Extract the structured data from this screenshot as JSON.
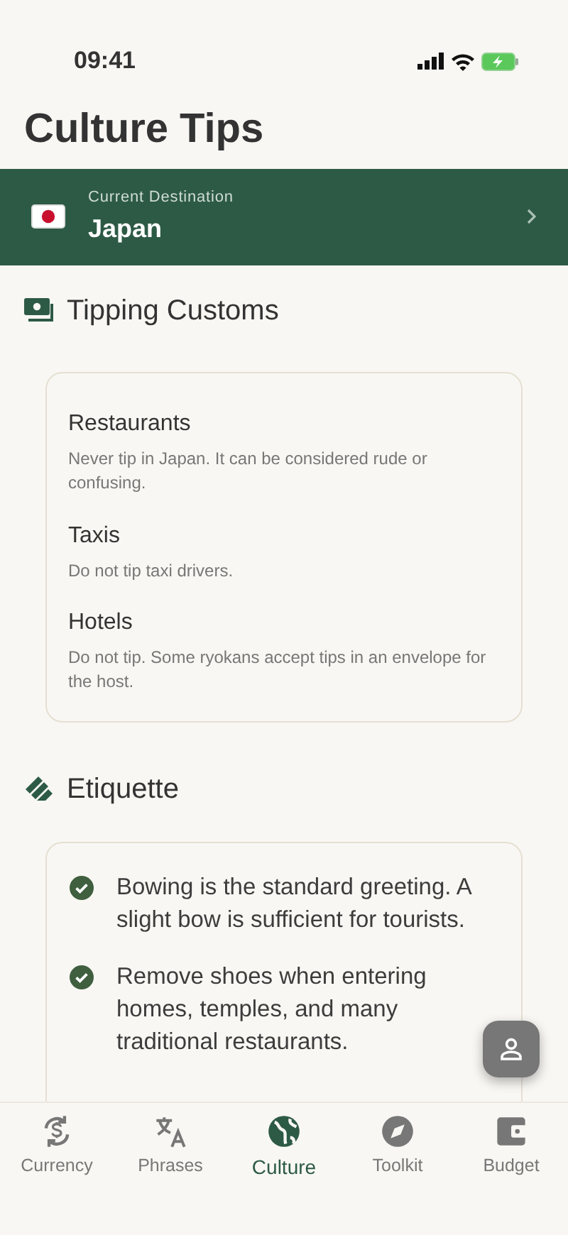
{
  "status_bar": {
    "time": "09:41"
  },
  "title": "Culture Tips",
  "destination": {
    "label": "Current Destination",
    "name": "Japan"
  },
  "tipping": {
    "heading": "Tipping Customs",
    "items": [
      {
        "title": "Restaurants",
        "text": "Never tip in Japan. It can be considered rude or confusing."
      },
      {
        "title": "Taxis",
        "text": "Do not tip taxi drivers."
      },
      {
        "title": "Hotels",
        "text": "Do not tip. Some ryokans accept tips in an envelope for the host."
      }
    ]
  },
  "etiquette": {
    "heading": "Etiquette",
    "items": [
      {
        "text": "Bowing is the standard greeting. A slight bow is sufficient for tourists.",
        "checked": true
      },
      {
        "text": "Remove shoes when entering homes, temples, and many traditional restaurants.",
        "checked": true
      }
    ]
  },
  "tabs": [
    {
      "label": "Currency",
      "selected": false
    },
    {
      "label": "Phrases",
      "selected": false
    },
    {
      "label": "Culture",
      "selected": true
    },
    {
      "label": "Toolkit",
      "selected": false
    },
    {
      "label": "Budget",
      "selected": false
    }
  ]
}
